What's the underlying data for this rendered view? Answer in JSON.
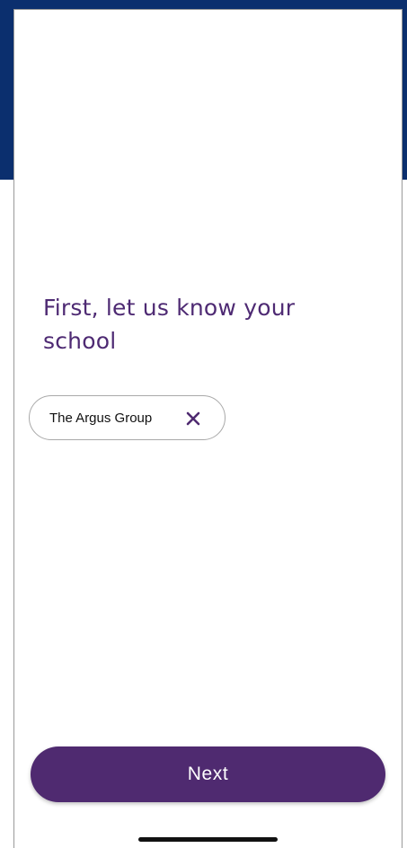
{
  "colors": {
    "header": "#0b2f6e",
    "accent": "#4f2a70",
    "title_text": "#4e2a73",
    "chip_border": "#a9a9a9"
  },
  "onboarding": {
    "title": "First, let us know your school",
    "selected_school": {
      "label": "The Argus Group",
      "remove_icon": "close-icon"
    },
    "next_label": "Next"
  }
}
